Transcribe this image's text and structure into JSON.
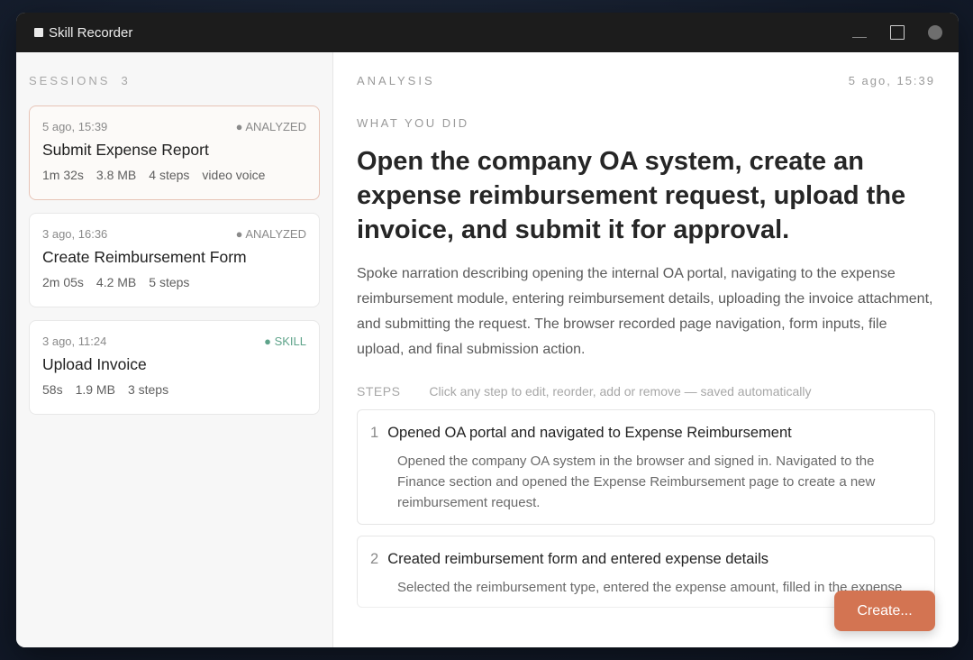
{
  "app": {
    "title": "Skill Recorder"
  },
  "sidebar": {
    "label": "SESSIONS",
    "count": "3",
    "sessions": [
      {
        "time": "5 ago, 15:39",
        "status": "● ANALYZED",
        "title": "Submit Expense Report",
        "duration": "1m 32s",
        "size": "3.8 MB",
        "steps": "4 steps",
        "tags": "video voice"
      },
      {
        "time": "3 ago, 16:36",
        "status": "● ANALYZED",
        "title": "Create Reimbursement Form",
        "duration": "2m 05s",
        "size": "4.2 MB",
        "steps": "5 steps"
      },
      {
        "time": "3 ago, 11:24",
        "status": "● SKILL",
        "title": "Upload Invoice",
        "duration": "58s",
        "size": "1.9 MB",
        "steps": "3 steps"
      }
    ]
  },
  "main": {
    "label": "ANALYSIS",
    "timestamp": "5 ago, 15:39",
    "section_label": "WHAT YOU DID",
    "headline": "Open the company OA system, create an expense reimbursement request, upload the invoice, and submit it for approval.",
    "description": "Spoke narration describing opening the internal OA portal, navigating to the expense reimbursement module, entering reimbursement details, uploading the invoice attachment, and submitting the request. The browser recorded page navigation, form inputs, file upload, and final submission action.",
    "steps_label": "STEPS",
    "steps_hint": "Click any step to edit, reorder, add or remove — saved automatically",
    "steps": [
      {
        "num": "1",
        "title": "Opened OA portal and navigated to Expense Reimbursement",
        "desc": "Opened the company OA system in the browser and signed in. Navigated to the Finance section and opened the Expense Reimbursement page to create a new reimbursement request."
      },
      {
        "num": "2",
        "title": "Created reimbursement form and entered expense details",
        "desc": "Selected the reimbursement type, entered the expense amount, filled in the expense"
      }
    ],
    "create_label": "Create..."
  },
  "colors": {
    "accent": "#d37452",
    "skill": "#5ea38a",
    "active_border": "#e7c4b7"
  }
}
